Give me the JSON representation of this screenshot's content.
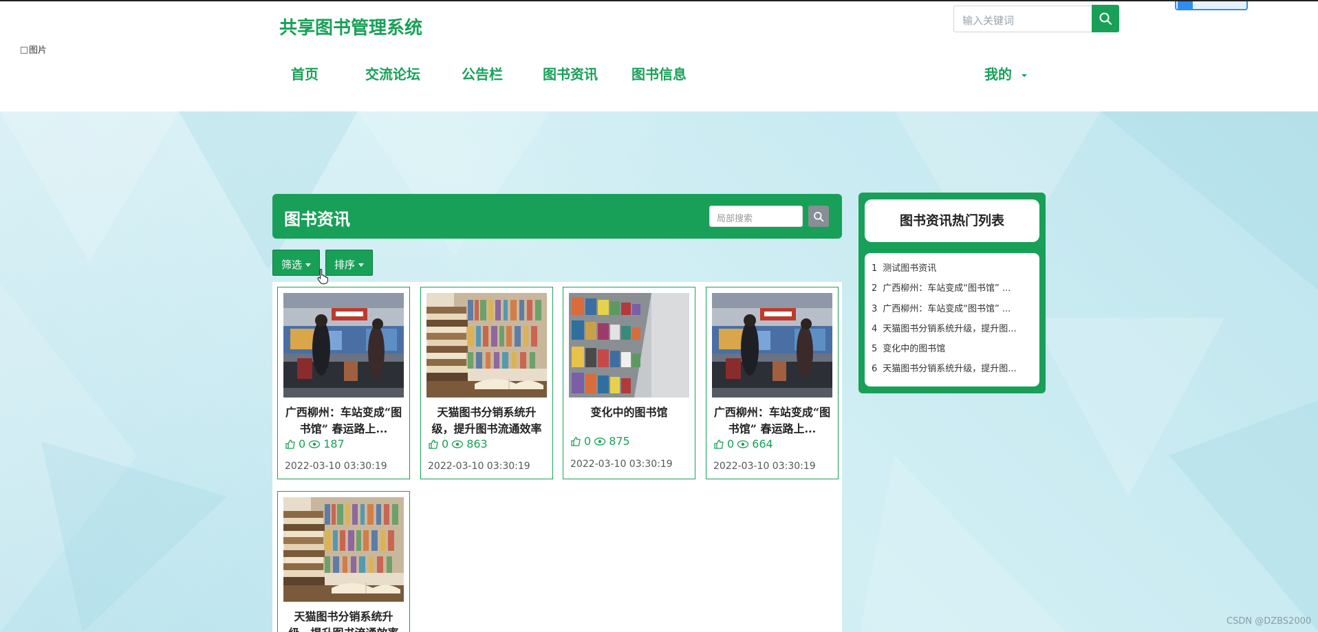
{
  "broken_image_alt": "图片",
  "site_title": "共享图书管理系统",
  "search": {
    "placeholder": "输入关键词"
  },
  "nav": [
    "首页",
    "交流论坛",
    "公告栏",
    "图书资讯",
    "图书信息"
  ],
  "nav_mine": "我的",
  "section": {
    "title": "图书资讯",
    "local_search_placeholder": "局部搜索",
    "filter_label": "筛选",
    "sort_label": "排序"
  },
  "cards": [
    {
      "title": "广西柳州：车站变成“图书馆” 春运路上...",
      "likes": "0",
      "views": "187",
      "date": "2022-03-10 03:30:19",
      "image": "station-reading-photo"
    },
    {
      "title": "天猫图书分销系统升级，提升图书流通效率",
      "likes": "0",
      "views": "863",
      "date": "2022-03-10 03:30:19",
      "image": "book-stack-photo"
    },
    {
      "title": "变化中的图书馆",
      "likes": "0",
      "views": "875",
      "date": "2022-03-10 03:30:19",
      "image": "bookshelf-photo"
    },
    {
      "title": "广西柳州：车站变成“图书馆” 春运路上...",
      "likes": "0",
      "views": "664",
      "date": "2022-03-10 03:30:19",
      "image": "station-reading-photo"
    },
    {
      "title": "天猫图书分销系统升级，提升图书流通效率",
      "likes": "",
      "views": "",
      "date": "",
      "image": "book-stack-photo"
    }
  ],
  "sidebar": {
    "title": "图书资讯热门列表",
    "items": [
      {
        "num": "1",
        "text": "测试图书资讯"
      },
      {
        "num": "2",
        "text": "广西柳州：车站变成“图书馆” ..."
      },
      {
        "num": "3",
        "text": "广西柳州：车站变成“图书馆” ..."
      },
      {
        "num": "4",
        "text": "天猫图书分销系统升级，提升图..."
      },
      {
        "num": "5",
        "text": "变化中的图书馆"
      },
      {
        "num": "6",
        "text": "天猫图书分销系统升级，提升图..."
      }
    ]
  },
  "watermark": "CSDN @DZBS2000",
  "colors": {
    "accent": "#18a058",
    "search_btn": "#888e94"
  }
}
